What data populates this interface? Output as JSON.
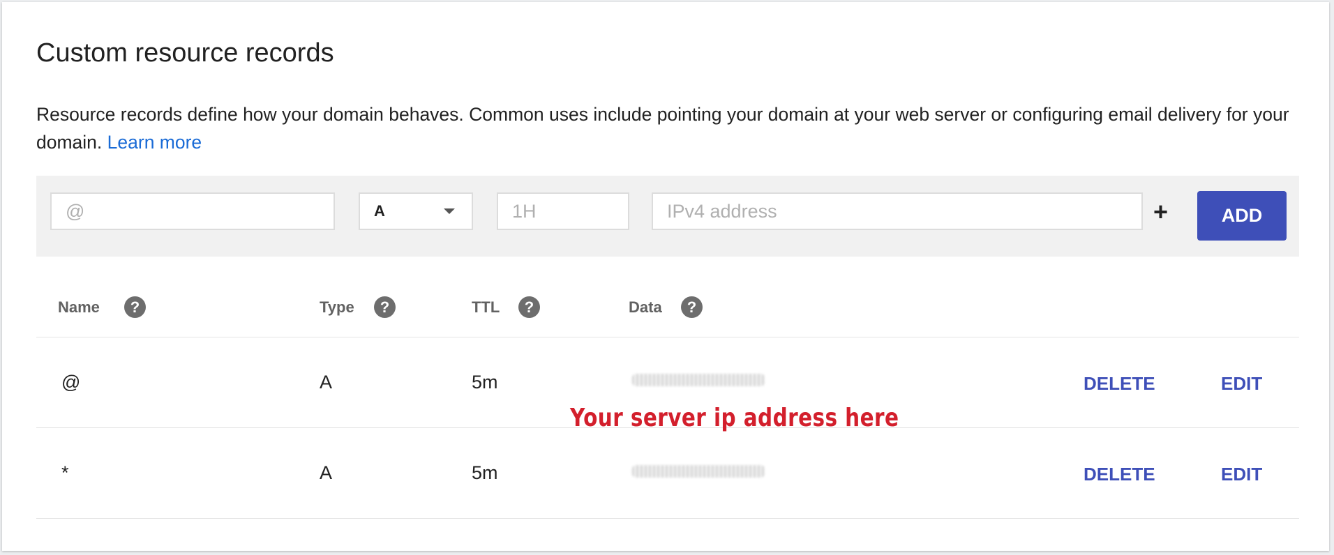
{
  "section": {
    "title": "Custom resource records",
    "description": "Resource records define how your domain behaves. Common uses include pointing your domain at your web server or configuring email delivery for your domain.",
    "learn_more": "Learn more"
  },
  "add_form": {
    "name_placeholder": "@",
    "type_value": "A",
    "ttl_placeholder": "1H",
    "data_placeholder": "IPv4 address",
    "plus_label": "+",
    "add_label": "ADD"
  },
  "table": {
    "headers": [
      {
        "label": "Name",
        "help": "?"
      },
      {
        "label": "Type",
        "help": "?"
      },
      {
        "label": "TTL",
        "help": "?"
      },
      {
        "label": "Data",
        "help": "?"
      }
    ],
    "rows": [
      {
        "name": "@",
        "type": "A",
        "ttl": "5m",
        "delete_label": "DELETE",
        "edit_label": "EDIT"
      },
      {
        "name": "*",
        "type": "A",
        "ttl": "5m",
        "delete_label": "DELETE",
        "edit_label": "EDIT"
      }
    ]
  },
  "annotation": "Your server ip address here",
  "colors": {
    "accent": "#3e4fb8",
    "link": "#1a6bd6",
    "annotation": "#d31f2c"
  }
}
